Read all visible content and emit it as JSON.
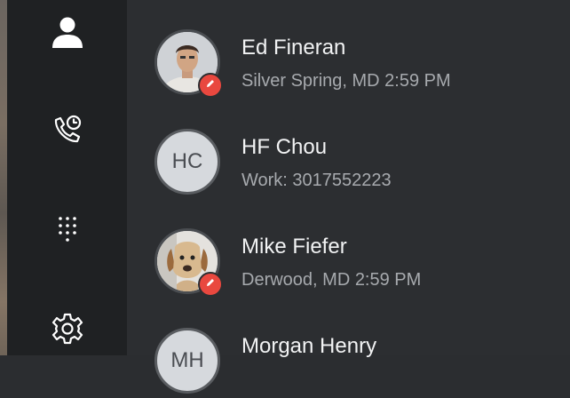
{
  "nav": {
    "items": [
      {
        "name": "contacts",
        "icon": "person-icon"
      },
      {
        "name": "calls",
        "icon": "phone-clock-icon"
      },
      {
        "name": "dialpad",
        "icon": "dialpad-icon"
      },
      {
        "name": "settings",
        "icon": "gear-icon"
      }
    ]
  },
  "contacts": [
    {
      "name": "Ed Fineran",
      "detail": "Silver Spring, MD 2:59 PM",
      "avatar": "photo",
      "editable": true
    },
    {
      "name": "HF Chou",
      "detail": "Work: 3017552223",
      "avatar": "initials",
      "initials": "HC",
      "editable": false
    },
    {
      "name": "Mike Fiefer",
      "detail": "Derwood, MD 2:59 PM",
      "avatar": "photo",
      "editable": true
    },
    {
      "name": "Morgan Henry",
      "detail": "",
      "avatar": "initials",
      "initials": "MH",
      "editable": false
    }
  ],
  "colors": {
    "rail_bg": "#1f2123",
    "main_bg": "#2c2e31",
    "name_text": "#f2f3f4",
    "detail_text": "#a7aaae",
    "edit_badge": "#e9483f"
  }
}
